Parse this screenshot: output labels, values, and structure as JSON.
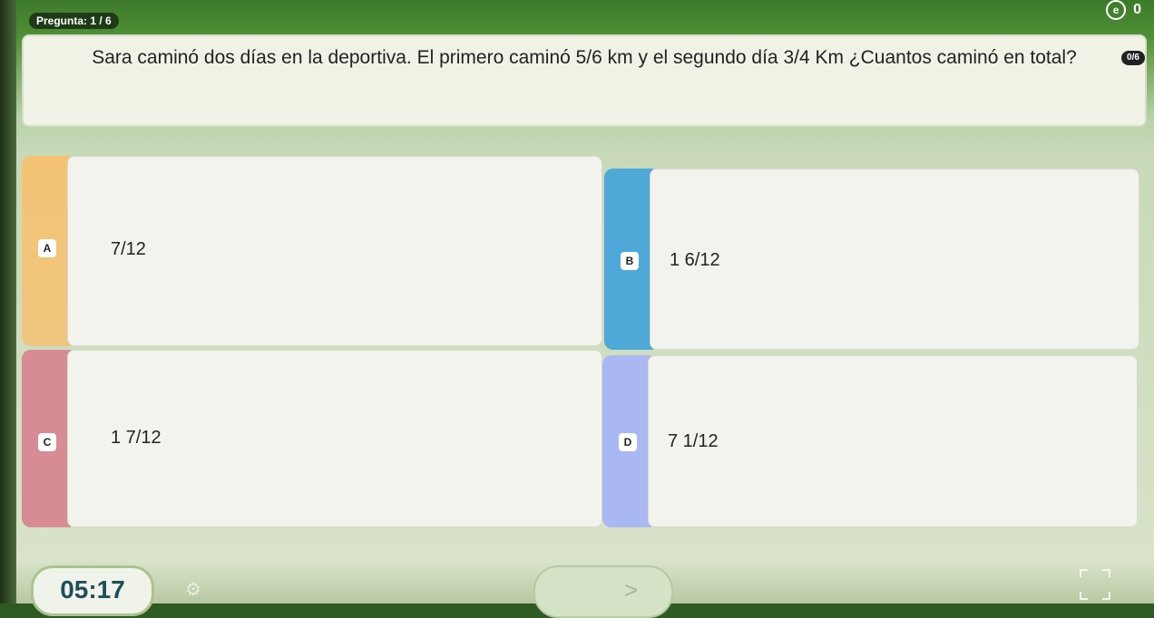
{
  "header": {
    "question_counter": "Pregunta: 1 / 6",
    "score": "0",
    "progress_badge": "0/6"
  },
  "question": {
    "text": "Sara caminó dos días en la deportiva. El primero caminó 5/6 km y el segundo día 3/4 Km ¿Cuantos caminó en total?"
  },
  "options": [
    {
      "letter": "A",
      "text": "7/12",
      "color": "#f4c474"
    },
    {
      "letter": "B",
      "text": "1 6/12",
      "color": "#4ea8d8"
    },
    {
      "letter": "C",
      "text": "1 7/12",
      "color": "#d78c95"
    },
    {
      "letter": "D",
      "text": "7 1/12",
      "color": "#a9b8f2"
    }
  ],
  "footer": {
    "timer": "05:17",
    "next_symbol": ">",
    "settings_icon": "sliders-icon",
    "fullscreen_icon": "fullscreen-icon"
  }
}
